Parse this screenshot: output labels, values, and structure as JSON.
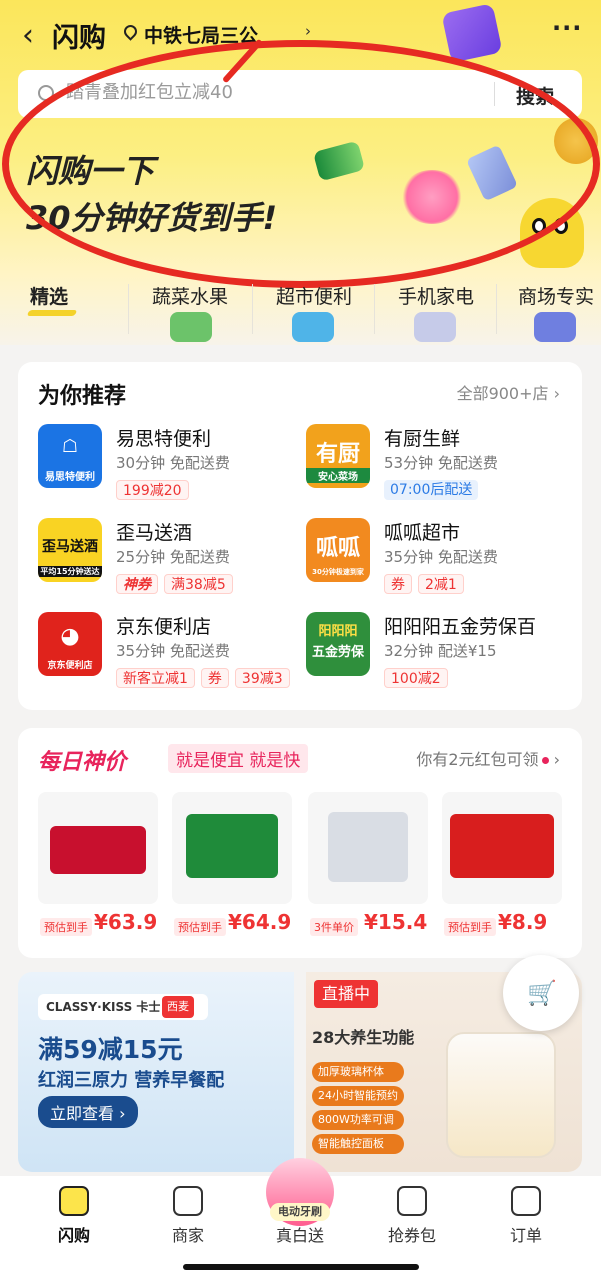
{
  "header": {
    "back_glyph": "‹",
    "title": "闪购",
    "location": "中铁七局三公",
    "location_arrow": "›",
    "more": "···"
  },
  "search": {
    "placeholder": "踏青叠加红包立减40",
    "button": "搜索"
  },
  "banner": {
    "line1": "闪购一下",
    "line2": "30分钟好货到手!"
  },
  "tabs": [
    {
      "label": "精选"
    },
    {
      "label": "蔬菜水果"
    },
    {
      "label": "超市便利"
    },
    {
      "label": "手机家电"
    },
    {
      "label": "商场专实"
    }
  ],
  "recommend": {
    "title": "为你推荐",
    "all_label": "全部900+店 ›",
    "stores": [
      {
        "name": "易思特便利",
        "meta": "30分钟  免配送费",
        "logo": "易思特便利",
        "tags": [
          "199减20"
        ]
      },
      {
        "name": "有厨生鲜",
        "meta": "53分钟  免配送费",
        "logo": "有厨",
        "logo_sub": "安心菜场",
        "tags": [
          "07:00后配送"
        ]
      },
      {
        "name": "歪马送酒",
        "meta": "25分钟  免配送费",
        "logo": "歪马送酒",
        "logo_sub": "平均15分钟送达",
        "tags": [
          "神券",
          "满38减5"
        ]
      },
      {
        "name": "呱呱超市",
        "meta": "35分钟  免配送费",
        "logo": "呱呱",
        "logo_sub": "30分钟极速到家",
        "tags": [
          "券",
          "2减1"
        ]
      },
      {
        "name": "京东便利店",
        "meta": "35分钟  免配送费",
        "logo": "京东便利店",
        "tags": [
          "新客立减1",
          "券",
          "39减3"
        ]
      },
      {
        "name": "阳阳阳五金劳保百",
        "meta": "32分钟  配送¥15",
        "logo": "阳阳阳",
        "logo_sub": "五金劳保",
        "tags": [
          "100减2"
        ]
      }
    ]
  },
  "daily": {
    "title": "每日神价",
    "subtitle": "就是便宜 就是快",
    "right_text": "你有2元红包可领",
    "products": [
      {
        "tag": "预估到手",
        "price": "¥63.9",
        "color": "#c8102e"
      },
      {
        "tag": "预估到手",
        "price": "¥64.9",
        "color": "#1f8b3a"
      },
      {
        "tag": "3件单价",
        "price": "¥15.4",
        "color": "#d9dde4"
      },
      {
        "tag": "预估到手",
        "price": "¥8.9",
        "color": "#d81e1e"
      }
    ]
  },
  "promo_left": {
    "brand": "CLASSY·KISS 卡士",
    "brand2": "西麦",
    "headline": "满59减15元",
    "sub": "红润三原力 营养早餐配",
    "button": "立即查看 ›"
  },
  "promo_right": {
    "live": "直播中",
    "headline": "28大养生功能",
    "features": [
      "加厚玻璃杯体",
      "24小时智能预约",
      "800W功率可调",
      "智能触控面板"
    ]
  },
  "center_tag": "电动牙刷",
  "bottom_nav": [
    {
      "label": "闪购"
    },
    {
      "label": "商家"
    },
    {
      "label": "真白送"
    },
    {
      "label": "抢券包"
    },
    {
      "label": "订单"
    }
  ],
  "colors": {
    "accent_yellow": "#fce44b",
    "price_red": "#e33333",
    "deal_pink": "#e8245c",
    "annotation_red": "#e62a22"
  }
}
